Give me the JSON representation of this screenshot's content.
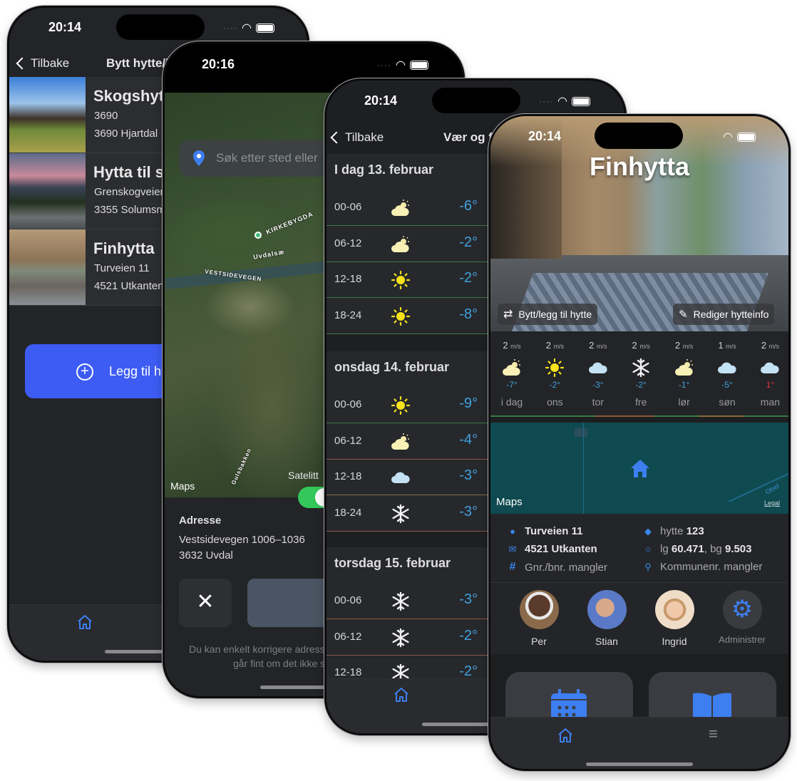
{
  "colors": {
    "accent": "#3d7ff0",
    "button_blue": "#3d5cf3",
    "temp_cold": "#41a1dc",
    "temp_warm": "#e0393c",
    "map_teal": "#0f4a50",
    "toggle_green": "#34c759"
  },
  "phone1": {
    "status_time": "20:14",
    "back_label": "Tilbake",
    "title": "Bytt hytte/l",
    "cabins": [
      {
        "name": "Skogshyt",
        "line1": "3690",
        "line2": "3690 Hjartdal"
      },
      {
        "name": "Hytta til s",
        "line1": "Grenskogveien",
        "line2": "3355 Solumsm"
      },
      {
        "name": "Finhytta",
        "line1": "Turveien 11",
        "line2": "4521 Utkanten"
      }
    ],
    "add_button": "Legg til h",
    "tab_icon": "home-icon"
  },
  "phone2": {
    "status_time": "20:16",
    "search_placeholder": "Søk etter sted eller",
    "map_labels": {
      "kirkebygda": "KIRKEBYGDA",
      "uvdalsae": "Uvdalsæ",
      "vestsidevegen": "VESTSIDEVEGEN",
      "gulsbakken": "Gulsbakken"
    },
    "maps_label": "Maps",
    "satellite_label": "Satelitt",
    "satellite_on": true,
    "address_heading": "Adresse",
    "address_line1": "Vestsidevegen 1006–1036",
    "address_line2": "3632 Uvdal",
    "cancel_icon": "close-icon",
    "footer_line1": "Du kan enkelt korrigere adress",
    "footer_line2": "går fint om det ikke s"
  },
  "phone3": {
    "status_time": "20:14",
    "back_label": "Tilbake",
    "title": "Vær og f",
    "days": [
      {
        "heading": "I dag 13. februar",
        "rows": [
          {
            "time": "00-06",
            "icon": "partly-cloudy",
            "temp": "-6°",
            "line": "#3d7a45"
          },
          {
            "time": "06-12",
            "icon": "partly-cloudy",
            "temp": "-2°",
            "line": "#3d7a45"
          },
          {
            "time": "12-18",
            "icon": "sun",
            "temp": "-2°",
            "line": "#3d7a45"
          },
          {
            "time": "18-24",
            "icon": "sun",
            "temp": "-8°",
            "line": "#3d7a45"
          }
        ]
      },
      {
        "heading": "onsdag 14. februar",
        "rows": [
          {
            "time": "00-06",
            "icon": "sun",
            "temp": "-9°",
            "line": "#3d7a45"
          },
          {
            "time": "06-12",
            "icon": "partly-cloudy",
            "temp": "-4°",
            "line": "#8a5a48"
          },
          {
            "time": "12-18",
            "icon": "cloud",
            "temp": "-3°",
            "line": "#8a7040"
          },
          {
            "time": "18-24",
            "icon": "snow",
            "temp": "-3°",
            "line": "#8a5a48"
          }
        ]
      },
      {
        "heading": "torsdag 15. februar",
        "rows": [
          {
            "time": "00-06",
            "icon": "snow",
            "temp": "-3°",
            "line": "#8a5a48"
          },
          {
            "time": "06-12",
            "icon": "snow",
            "temp": "-2°",
            "line": "#8a5a48"
          },
          {
            "time": "12-18",
            "icon": "snow",
            "temp": "-2°",
            "line": "#8a5a48"
          }
        ]
      }
    ]
  },
  "phone4": {
    "status_time": "20:14",
    "cabin_name": "Finhytta",
    "switch_button": "Bytt/legg til hytte",
    "edit_button": "Rediger hytteinfo",
    "forecast": [
      {
        "wind": "2",
        "unit": "m/s",
        "icon": "partly-cloudy",
        "temp": "-7°",
        "day": "i dag",
        "warm": false
      },
      {
        "wind": "2",
        "unit": "m/s",
        "icon": "sun",
        "temp": "-2°",
        "day": "ons",
        "warm": false
      },
      {
        "wind": "2",
        "unit": "m/s",
        "icon": "cloud",
        "temp": "-3°",
        "day": "tor",
        "warm": false
      },
      {
        "wind": "2",
        "unit": "m/s",
        "icon": "snow",
        "temp": "-2°",
        "day": "fre",
        "warm": false
      },
      {
        "wind": "2",
        "unit": "m/s",
        "icon": "partly-cloudy",
        "temp": "-1°",
        "day": "lør",
        "warm": false
      },
      {
        "wind": "1",
        "unit": "m/s",
        "icon": "cloud",
        "temp": "-5°",
        "day": "søn",
        "warm": false
      },
      {
        "wind": "2",
        "unit": "m/s",
        "icon": "cloud",
        "temp": "1°",
        "day": "man",
        "warm": true
      }
    ],
    "maps_label": "Maps",
    "legal_label": "Legal",
    "map_place": "Olsel",
    "info": {
      "street": "Turveien 11",
      "postal": "4521 Utkanten",
      "gnr": "Gnr./bnr. mangler",
      "hytte_prefix": "hytte",
      "hytte_num": "123",
      "lg_prefix": "lg",
      "lg": "60.471",
      "bg_prefix": ", bg",
      "bg": "9.503",
      "kommune": "Kommunenr. mangler"
    },
    "people": [
      {
        "name": "Per"
      },
      {
        "name": "Stian"
      },
      {
        "name": "Ingrid"
      }
    ],
    "admin_label": "Administrer"
  }
}
